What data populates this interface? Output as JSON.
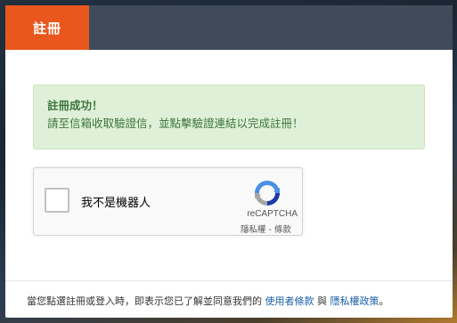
{
  "header": {
    "tab_register": "註冊"
  },
  "alert": {
    "title": "註冊成功！",
    "message": "請至信箱收取驗證信，並點擊驗證連結以完成註冊！"
  },
  "captcha": {
    "label": "我不是機器人",
    "brand": "reCAPTCHA",
    "privacy_link": "隱私權",
    "separator": " - ",
    "terms_link": "條款",
    "logo_icon": "recaptcha-logo-icon"
  },
  "footer": {
    "prefix": "當您點選註冊或登入時，即表示您已了解並同意我們的",
    "terms_link": "使用者條款",
    "connector": "與",
    "privacy_link": "隱私權政策",
    "suffix": "。"
  },
  "colors": {
    "accent": "#e9571e",
    "header_bg": "#3f4b5a",
    "success_bg": "#dff0d8",
    "success_text": "#3c763d",
    "link": "#1a5ea8"
  }
}
